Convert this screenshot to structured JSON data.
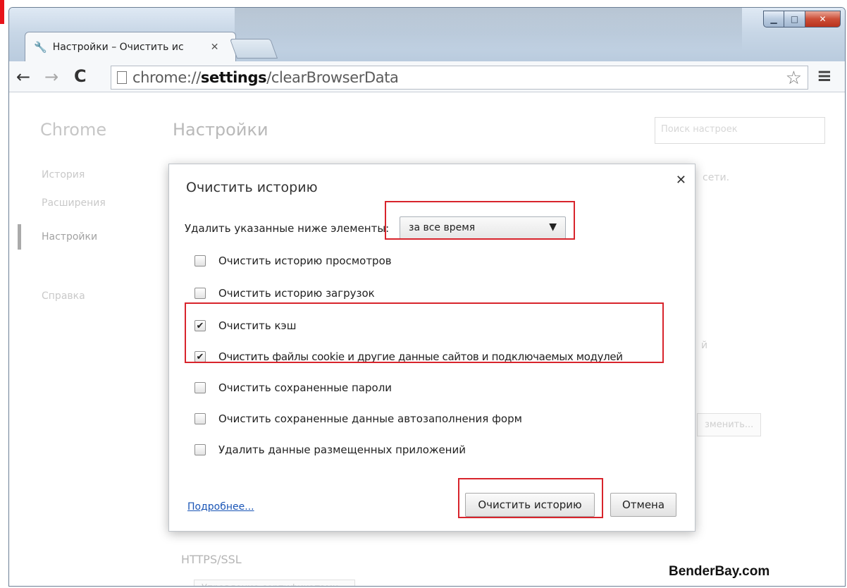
{
  "browser": {
    "tab_title": "Настройки – Очистить ис",
    "tab_icon": "wrench-icon",
    "url_scheme": "chrome://",
    "url_host": "settings",
    "url_path": "/clearBrowserData"
  },
  "settings_page": {
    "brand": "Chrome",
    "title": "Настройки",
    "search_placeholder": "Поиск настроек",
    "sidebar": [
      {
        "label": "История"
      },
      {
        "label": "Расширения"
      },
      {
        "label": "Настройки"
      },
      {
        "label": "Справка"
      }
    ],
    "ghost_text_1": "сети.",
    "ghost_text_2": "й",
    "ghost_button": "зменить...",
    "section_https": "HTTPS/SSL",
    "cert_button": "Управление сертификатами..."
  },
  "dialog": {
    "title": "Очистить историю",
    "range_label": "Удалить указанные ниже элементы:",
    "range_value": "за все время",
    "options": [
      {
        "label": "Очистить историю просмотров",
        "checked": false
      },
      {
        "label": "Очистить историю загрузок",
        "checked": false
      },
      {
        "label": "Очистить кэш",
        "checked": true
      },
      {
        "label": "Очистить файлы cookie и другие данные сайтов и подключаемых модулей",
        "checked": true
      },
      {
        "label": "Очистить сохраненные пароли",
        "checked": false
      },
      {
        "label": "Очистить сохраненные данные автозаполнения форм",
        "checked": false
      },
      {
        "label": "Удалить данные размещенных приложений",
        "checked": false
      }
    ],
    "more_link": "Подробнее...",
    "clear_button": "Очистить историю",
    "cancel_button": "Отмена"
  },
  "watermark": "BenderBay.com",
  "colors": {
    "highlight": "#d8242c",
    "link": "#1a55b6"
  }
}
